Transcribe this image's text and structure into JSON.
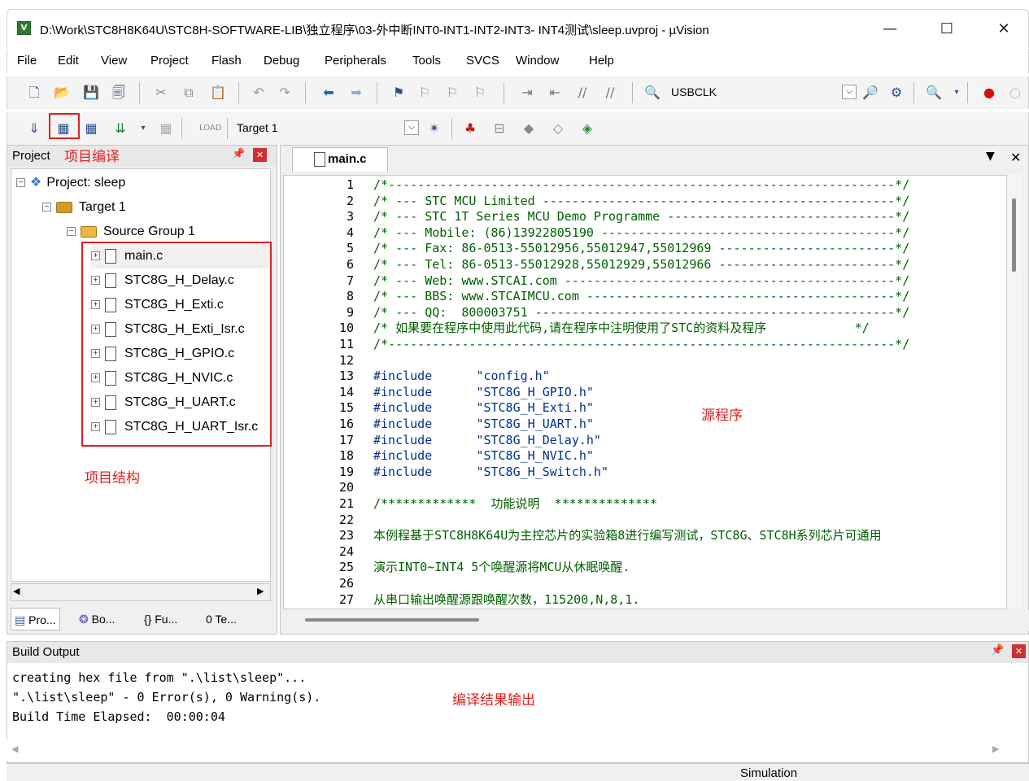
{
  "window": {
    "title": "D:\\Work\\STC8H8K64U\\STC8H-SOFTWARE-LIB\\独立程序\\03-外中断INT0-INT1-INT2-INT3- INT4测试\\sleep.uvproj - µVision",
    "minimize": "—",
    "maximize": "☐",
    "close": "✕"
  },
  "menu": [
    "File",
    "Edit",
    "View",
    "Project",
    "Flash",
    "Debug",
    "Peripherals",
    "Tools",
    "SVCS",
    "Window",
    "Help"
  ],
  "toolbar1": {
    "combo_value": "USBCLK"
  },
  "toolbar2": {
    "target_value": "Target 1"
  },
  "project_panel": {
    "title": "Project",
    "annotation": "项目编译",
    "tree": {
      "root": "Project: sleep",
      "target": "Target 1",
      "group": "Source Group 1",
      "files": [
        "main.c",
        "STC8G_H_Delay.c",
        "STC8G_H_Exti.c",
        "STC8G_H_Exti_Isr.c",
        "STC8G_H_GPIO.c",
        "STC8G_H_NVIC.c",
        "STC8G_H_UART.c",
        "STC8G_H_UART_Isr.c"
      ]
    },
    "structure_annotation": "项目结构",
    "tabs": [
      "Pro...",
      "Bo...",
      "{} Fu...",
      "0 Te..."
    ]
  },
  "editor": {
    "tab": "main.c",
    "annotation": "源程序",
    "lines": [
      "/*---------------------------------------------------------------------*/",
      "/* --- STC MCU Limited ------------------------------------------------*/",
      "/* --- STC 1T Series MCU Demo Programme -------------------------------*/",
      "/* --- Mobile: (86)13922805190 ----------------------------------------*/",
      "/* --- Fax: 86-0513-55012956,55012947,55012969 ------------------------*/",
      "/* --- Tel: 86-0513-55012928,55012929,55012966 ------------------------*/",
      "/* --- Web: www.STCAI.com ---------------------------------------------*/",
      "/* --- BBS: www.STCAIMCU.com ------------------------------------------*/",
      "/* --- QQ:  800003751 -------------------------------------------------*/",
      "/* 如果要在程序中使用此代码,请在程序中注明使用了STC的资料及程序            */",
      "/*---------------------------------------------------------------------*/",
      "",
      "#include      \"config.h\"",
      "#include      \"STC8G_H_GPIO.h\"",
      "#include      \"STC8G_H_Exti.h\"",
      "#include      \"STC8G_H_UART.h\"",
      "#include      \"STC8G_H_Delay.h\"",
      "#include      \"STC8G_H_NVIC.h\"",
      "#include      \"STC8G_H_Switch.h\"",
      "",
      "/*************  功能说明  **************",
      "",
      "本例程基于STC8H8K64U为主控芯片的实验箱8进行编写测试，STC8G、STC8H系列芯片可通用",
      "",
      "演示INT0~INT4 5个唤醒源将MCU从休眠唤醒.",
      "",
      "从串口输出唤醒源跟唤醒次数，115200,N,8,1."
    ]
  },
  "build_output": {
    "title": "Build Output",
    "text": "creating hex file from \".\\list\\sleep\"...\n\".\\list\\sleep\" - 0 Error(s), 0 Warning(s).\nBuild Time Elapsed:  00:00:04",
    "annotation": "编译结果输出"
  },
  "status": {
    "mode": "Simulation"
  }
}
